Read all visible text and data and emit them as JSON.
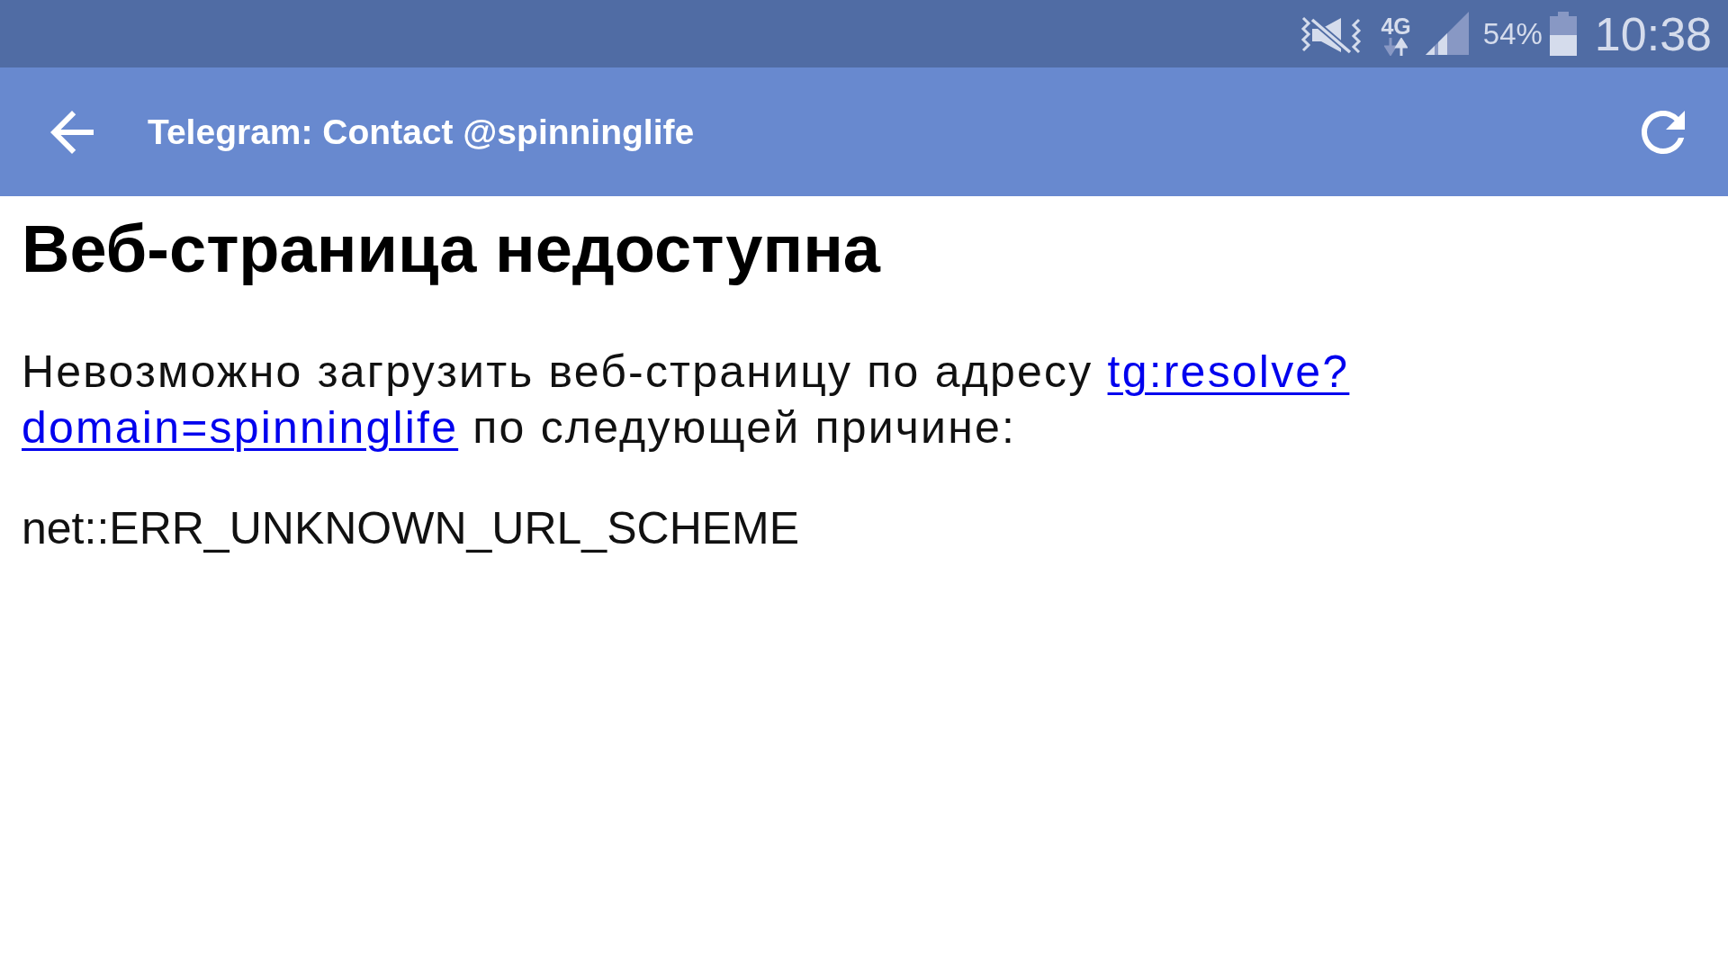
{
  "status_bar": {
    "network": "4G",
    "battery": "54%",
    "time": "10:38"
  },
  "app_bar": {
    "title": "Telegram: Contact @spinninglife"
  },
  "page": {
    "heading": "Веб-страница недоступна",
    "message": [
      {
        "kind": "text",
        "text": "Невозможно загрузить веб-страницу по адресу "
      },
      {
        "kind": "link",
        "text": "tg:resolve?"
      },
      {
        "kind": "link",
        "text": "domain=spinninglife"
      },
      {
        "kind": "text",
        "text": " по следующей причине:"
      }
    ],
    "error_code": "net::ERR_UNKNOWN_URL_SCHEME"
  }
}
